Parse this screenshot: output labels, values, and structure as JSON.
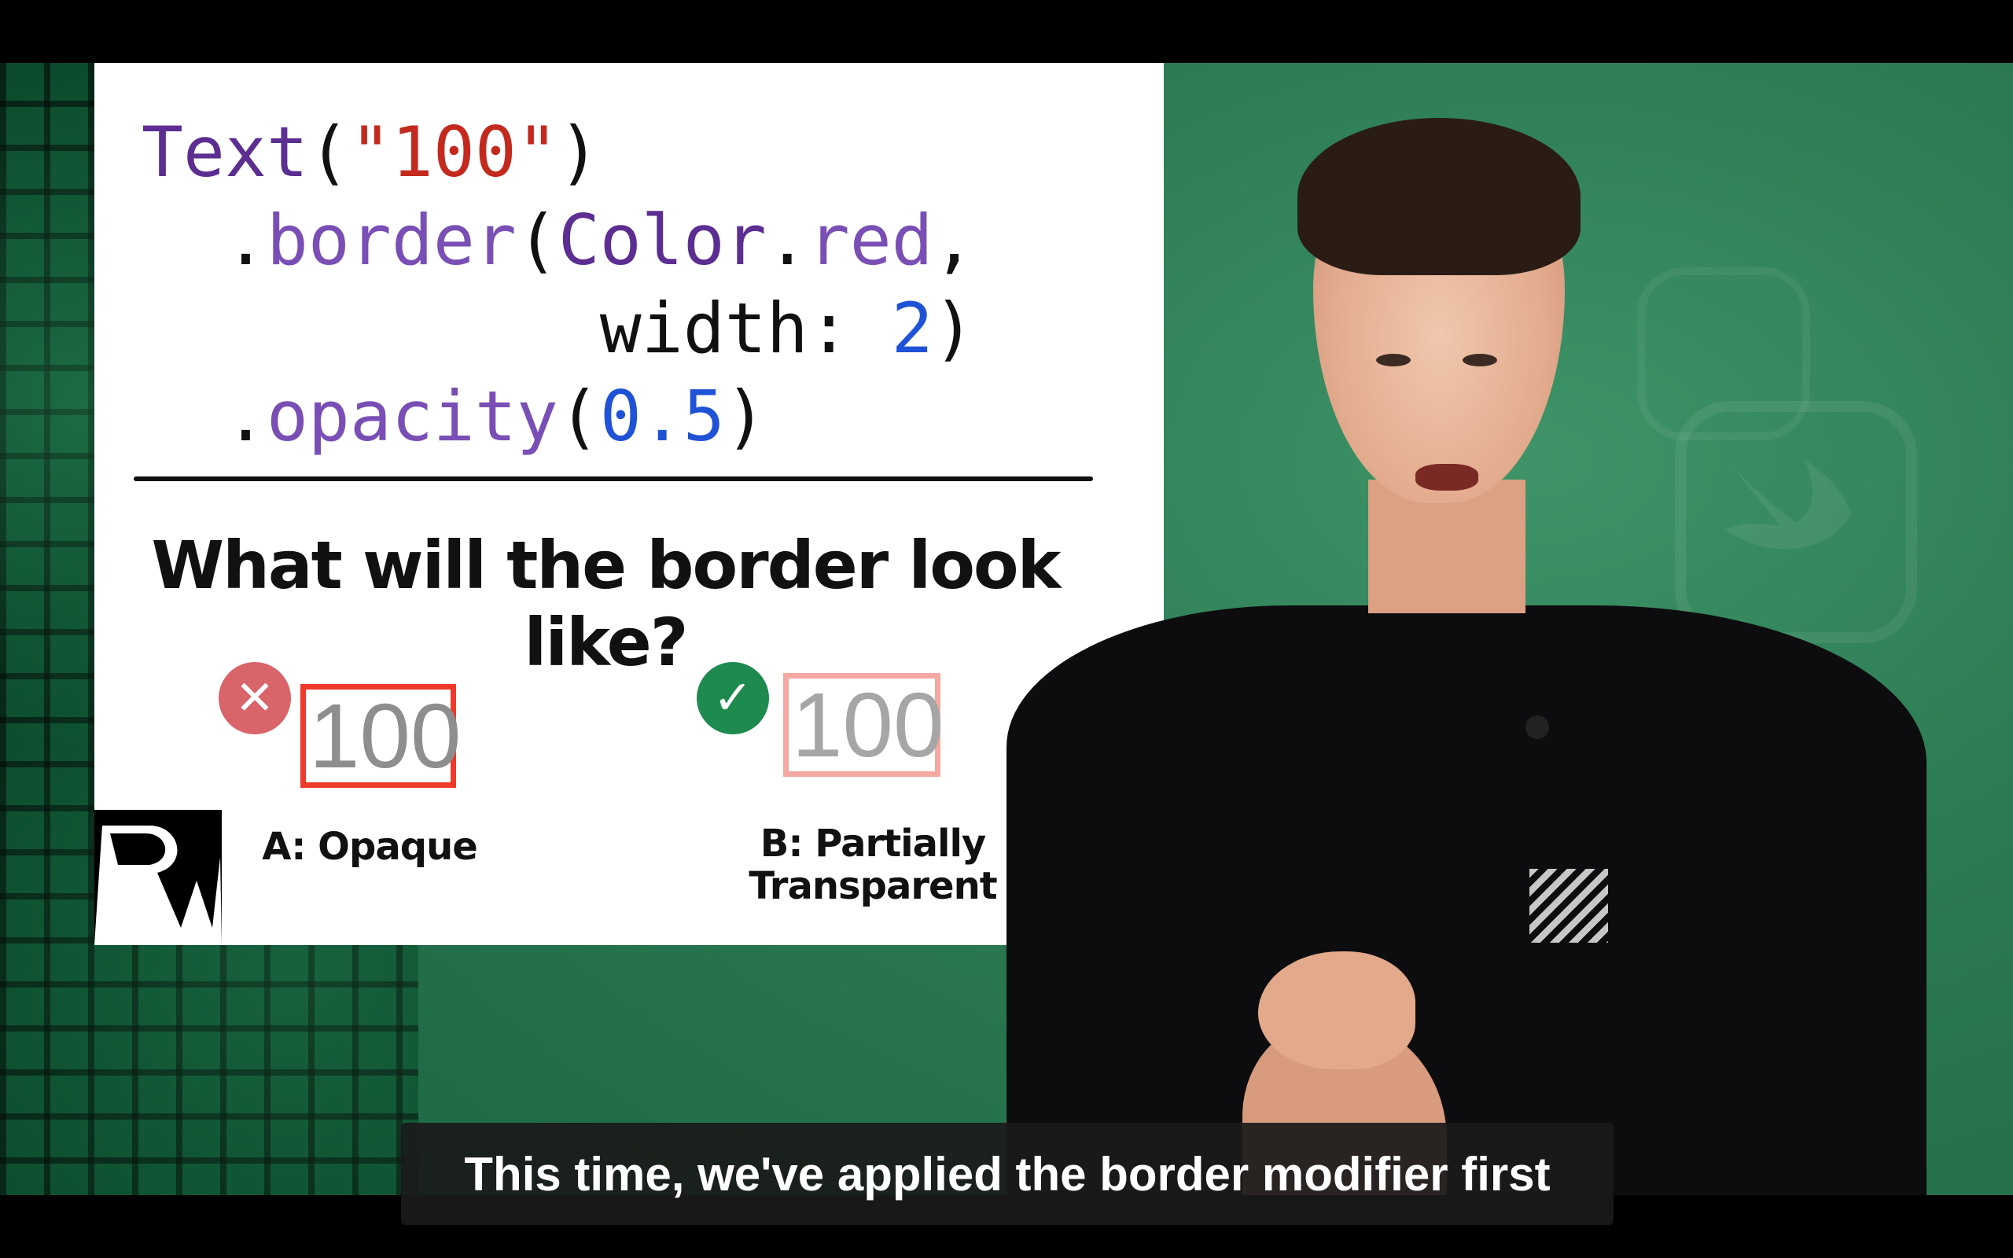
{
  "slide": {
    "code": {
      "line1": {
        "type": "Text",
        "open": "(",
        "str": "\"100\"",
        "close": ")"
      },
      "line2": {
        "dot": ".",
        "method": "border",
        "open": "(",
        "type": "Color",
        "dot2": ".",
        "member": "red",
        "comma": ","
      },
      "line3": {
        "label": "width:",
        "num": "2",
        "close": ")"
      },
      "line4": {
        "dot": ".",
        "method": "opacity",
        "open": "(",
        "num": "0.5",
        "close": ")"
      }
    },
    "question": "What will the border look like?",
    "option_a": {
      "sample": "100",
      "label": "A: Opaque",
      "status": "incorrect"
    },
    "option_b": {
      "sample": "100",
      "label_line1": "B: Partially",
      "label_line2": "Transparent",
      "status": "correct"
    },
    "icons": {
      "wrong": "close-icon",
      "right": "check-icon",
      "brand": "rw-logo"
    }
  },
  "caption": {
    "text": "This time, we've applied the border modifier first"
  },
  "colors": {
    "code_type": "#5c2e91",
    "code_string": "#c4291d",
    "code_method": "#7a4fb5",
    "code_number": "#1f52d6",
    "border_red": "#ee3a2a",
    "border_faded": "#f5a9a2",
    "wrong_badge": "#d9646a",
    "right_badge": "#1e8a4f",
    "background_green": "#2f7d55"
  }
}
